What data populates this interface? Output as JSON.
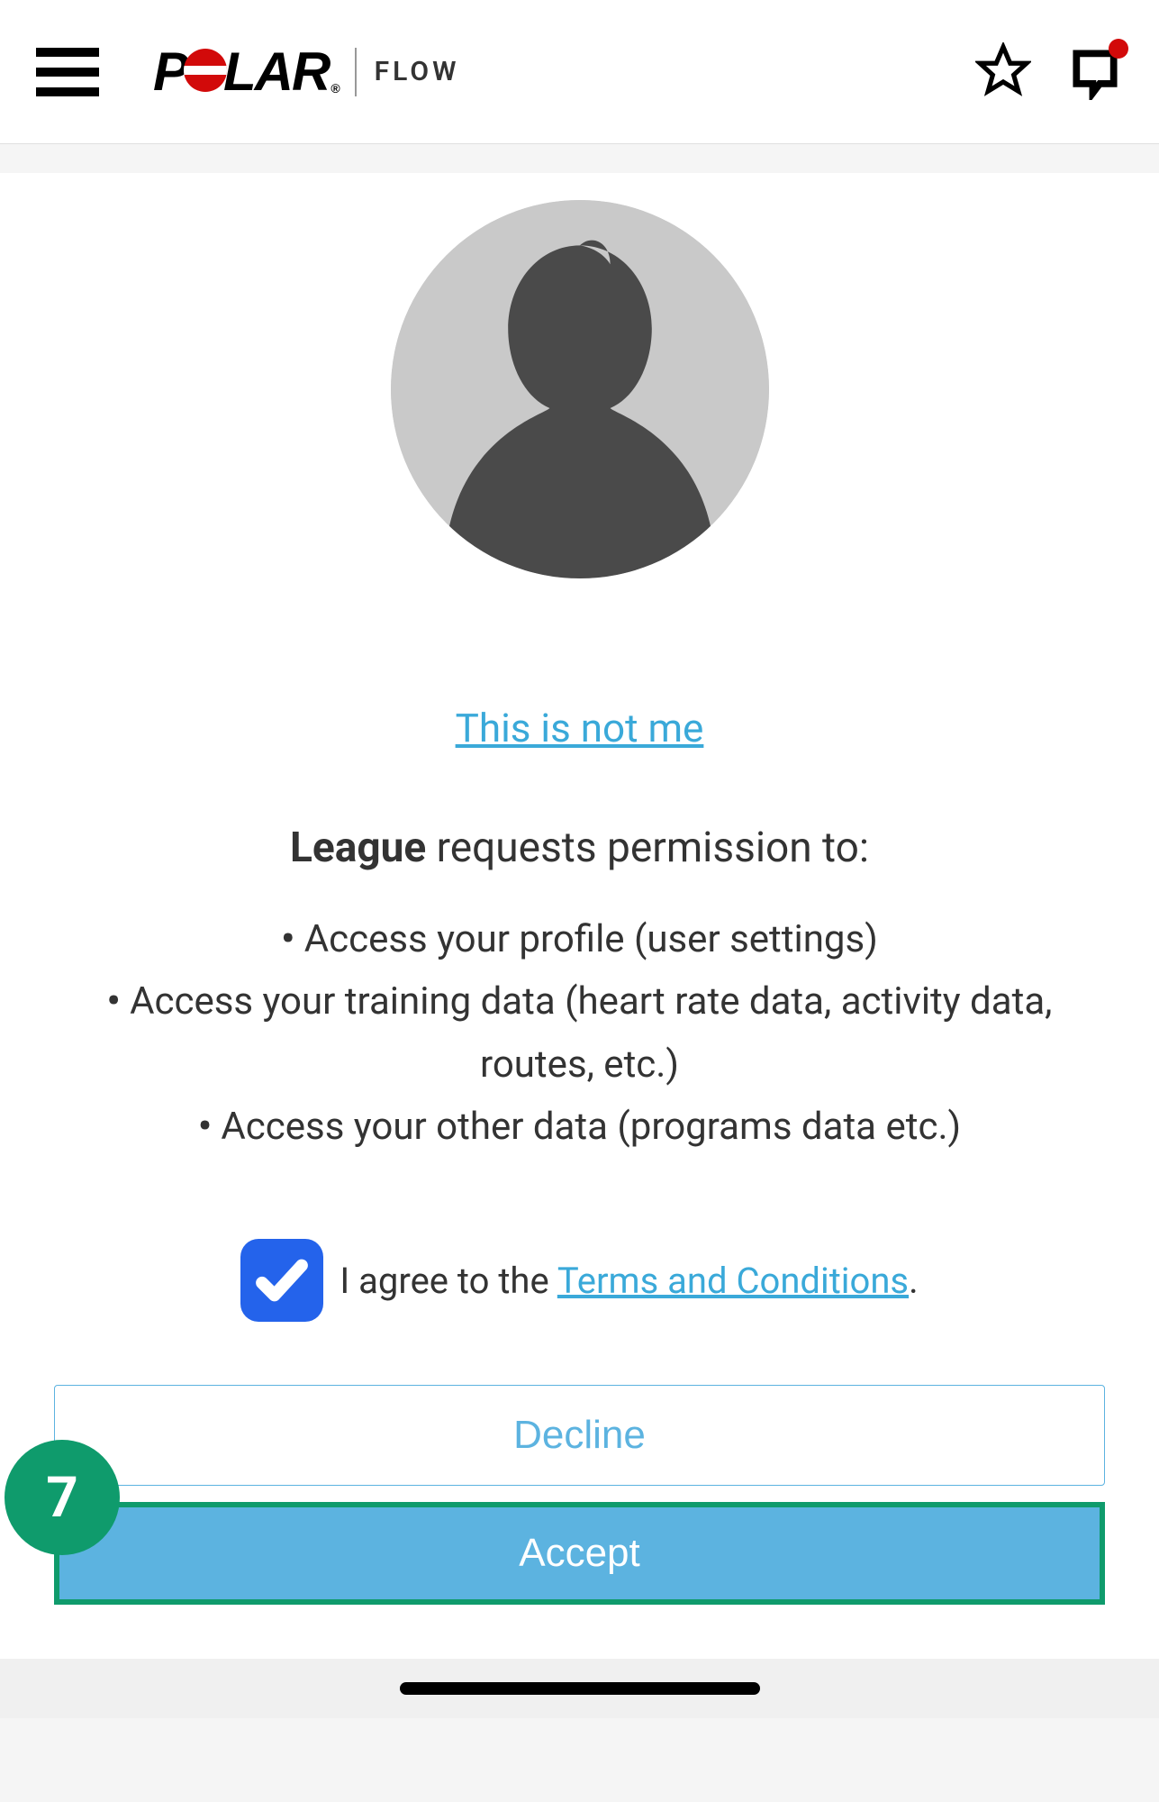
{
  "header": {
    "brand_main": "POLAR",
    "brand_sub": "FLOW"
  },
  "main": {
    "not_me_link": "This is not me",
    "app_name": "League",
    "permission_suffix": " requests permission to:",
    "permissions": [
      "Access your profile (user settings)",
      "Access your training data (heart rate data, activity data, routes, etc.)",
      "Access your other data (programs data etc.)"
    ],
    "agree_prefix": "I agree to the ",
    "terms_link_text": "Terms and Conditions",
    "agree_suffix": ".",
    "decline_label": "Decline",
    "accept_label": "Accept",
    "step_number": "7"
  }
}
